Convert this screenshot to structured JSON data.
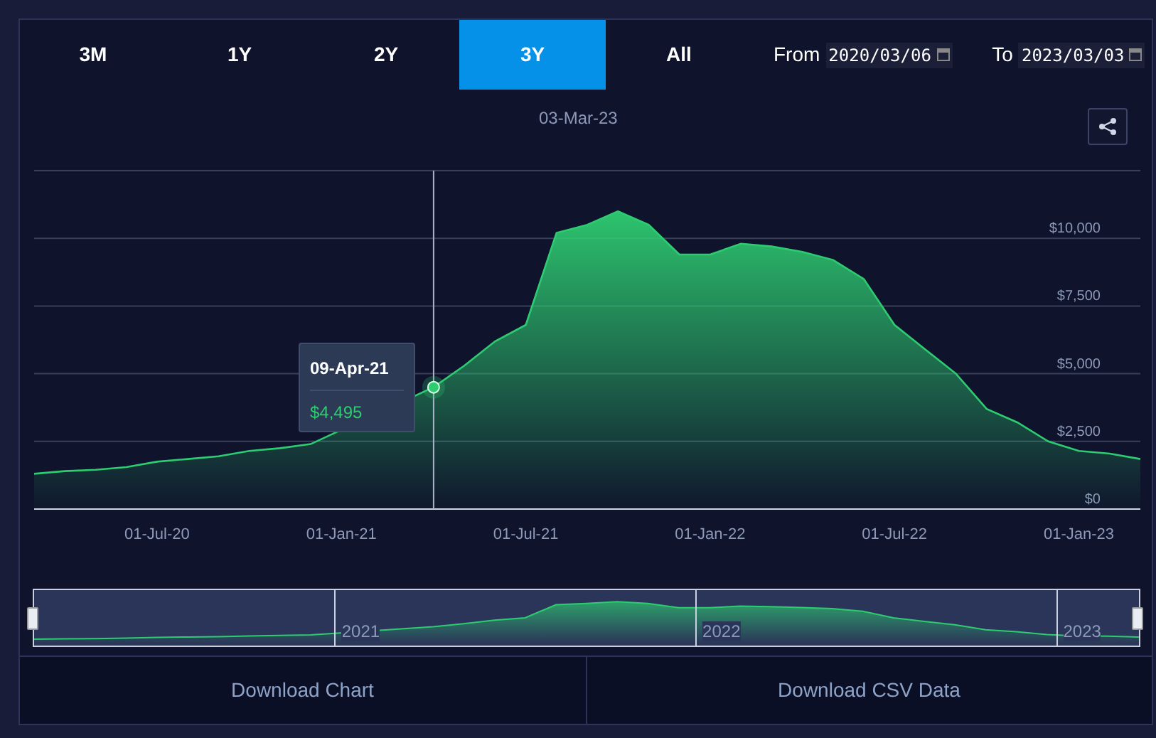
{
  "tabs": [
    {
      "label": "3M",
      "selected": false
    },
    {
      "label": "1Y",
      "selected": false
    },
    {
      "label": "2Y",
      "selected": false
    },
    {
      "label": "3Y",
      "selected": true
    },
    {
      "label": "All",
      "selected": false
    }
  ],
  "range": {
    "from_label": "From",
    "from_value": "2020/03/06",
    "to_label": "To",
    "to_value": "2023/03/03"
  },
  "chart_title": "03-Mar-23",
  "chart_data": {
    "type": "area",
    "ylim": [
      0,
      12500
    ],
    "grid": true,
    "categories": [
      null,
      null,
      null,
      null,
      "01-Jul-20",
      null,
      null,
      null,
      null,
      null,
      "01-Jan-21",
      null,
      null,
      null,
      null,
      null,
      "01-Jul-21",
      null,
      null,
      null,
      null,
      null,
      "01-Jan-22",
      null,
      null,
      null,
      null,
      null,
      "01-Jul-22",
      null,
      null,
      null,
      null,
      null,
      "01-Jan-23",
      null,
      null
    ],
    "series": [
      {
        "color": "#2ecc71",
        "values": [
          1300,
          1400,
          1450,
          1550,
          1750,
          1850,
          1950,
          2150,
          2250,
          2400,
          null,
          null,
          null,
          4500,
          5300,
          6200,
          6800,
          10200,
          10500,
          11000,
          10500,
          9400,
          9400,
          9800,
          9700,
          9500,
          9200,
          8500,
          6800,
          5900,
          5000,
          3700,
          3200,
          2500,
          2150,
          2050,
          1850
        ]
      }
    ],
    "yticks": [
      {
        "value": 0,
        "label": "$0"
      },
      {
        "value": 2500,
        "label": "$2,500"
      },
      {
        "value": 5000,
        "label": "$5,000"
      },
      {
        "value": 7500,
        "label": "$7,500"
      },
      {
        "value": 10000,
        "label": "$10,000"
      }
    ]
  },
  "tooltip": {
    "date": "09-Apr-21",
    "price": "$4,495"
  },
  "navigator": {
    "years": [
      "2021",
      "2022",
      "2023"
    ]
  },
  "buttons": [
    "Download Chart",
    "Download CSV Data"
  ]
}
